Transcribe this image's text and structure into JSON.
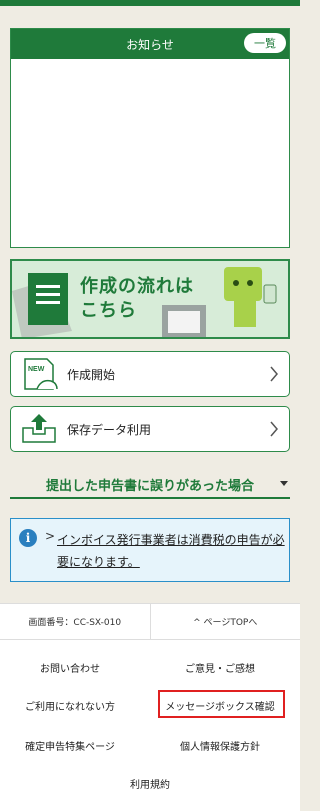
{
  "notice": {
    "title": "お知らせ",
    "list_button": "一覧"
  },
  "banner": {
    "line1": "作成の流れは",
    "line2": "こちら"
  },
  "actions": [
    {
      "label": "作成開始",
      "icon": "new-document-hand-icon"
    },
    {
      "label": "保存データ利用",
      "icon": "upload-tray-icon"
    }
  ],
  "mistake_section": {
    "title": "提出した申告書に誤りがあった場合"
  },
  "info": {
    "arrow": ">",
    "text": "インボイス発行事業者は消費税の申告が必要になります。"
  },
  "footer": {
    "screen_number": "画面番号：CC-SX-010",
    "page_top": "^ ページTOPへ",
    "links": {
      "inquiry": "お問い合わせ",
      "feedback": "ご意見・ご感想",
      "unavailable": "ご利用になれない方",
      "message_box": "メッセージボックス確認",
      "special_page": "確定申告特集ページ",
      "privacy": "個人情報保護方針",
      "terms": "利用規約"
    }
  },
  "colors": {
    "brand_green": "#1f7a3a",
    "info_blue": "#2a8fc9",
    "highlight_red": "#e02020"
  }
}
